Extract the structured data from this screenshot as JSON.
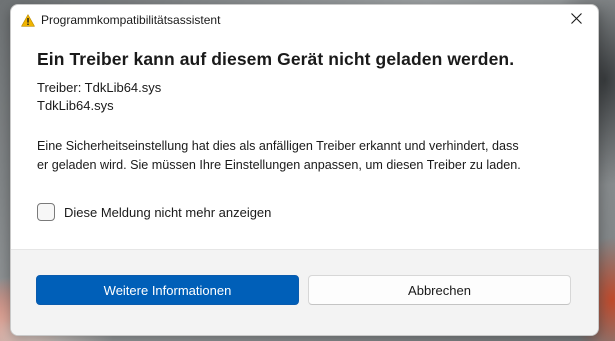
{
  "window": {
    "title": "Programmkompatibilitätsassistent",
    "icon": "warning-icon",
    "close_icon": "close-icon"
  },
  "content": {
    "heading": "Ein Treiber kann auf diesem Gerät nicht geladen werden.",
    "driver_line": "Treiber: TdkLib64.sys",
    "driver_file": "TdkLib64.sys",
    "description_line1": "Eine Sicherheitseinstellung hat dies als anfälligen Treiber erkannt und verhindert, dass",
    "description_line2": "er geladen wird. Sie müssen Ihre Einstellungen anpassen, um diesen Treiber zu laden."
  },
  "checkbox": {
    "label": "Diese Meldung nicht mehr anzeigen",
    "checked": false
  },
  "buttons": {
    "primary_label": "Weitere Informationen",
    "secondary_label": "Abbrechen"
  },
  "colors": {
    "accent": "#005fb8",
    "warning": "#f0b400"
  }
}
